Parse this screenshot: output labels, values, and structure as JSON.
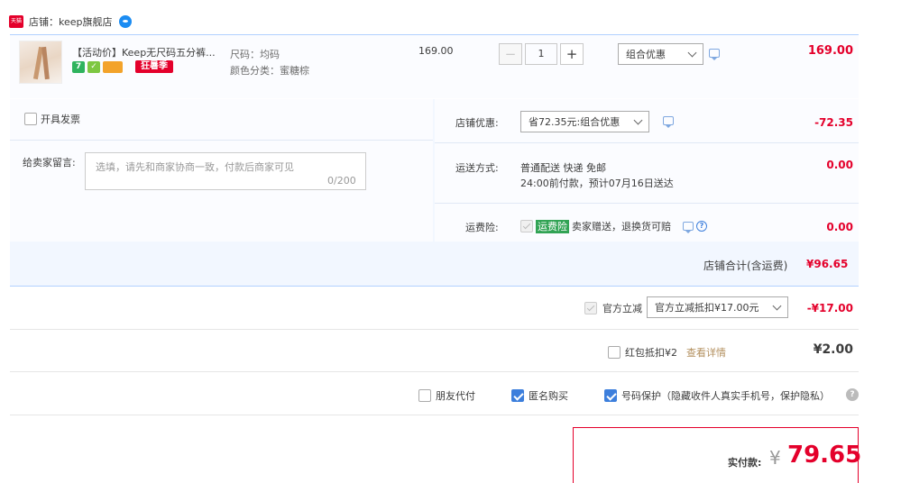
{
  "shop": {
    "badge": "天猫",
    "name": "店铺：keep旗舰店"
  },
  "item": {
    "title": "【活动价】Keep无尺码五分裤...",
    "promo_tag": "狂暑季",
    "sku_size": "尺码：均码",
    "sku_color": "颜色分类：蜜糖棕",
    "unit_price": "169.00",
    "quantity": "1",
    "minus": "−",
    "plus": "+",
    "promo_select": "组合优惠",
    "total": "169.00"
  },
  "invoice": {
    "label": "开具发票"
  },
  "message": {
    "label": "给卖家留言:",
    "placeholder": "选填，请先和商家协商一致，付款后商家可见",
    "count": "0/200"
  },
  "shop_discount": {
    "label": "店铺优惠:",
    "select": "省72.35元:组合优惠",
    "amount": "-72.35"
  },
  "shipping": {
    "label": "运送方式:",
    "method": "普通配送 快递 免邮",
    "eta": "24:00前付款，预计07月16日送达",
    "amount": "0.00"
  },
  "freight_insurance": {
    "label": "运费险:",
    "tag": "运费险",
    "desc": "卖家赠送，退换货可赔",
    "amount": "0.00"
  },
  "shop_total": {
    "label": "店铺合计(含运费)",
    "value": "¥96.65"
  },
  "official_discount": {
    "label": "官方立减",
    "select": "官方立减抵扣¥17.00元",
    "amount": "-¥17.00"
  },
  "red_packet": {
    "label": "红包抵扣¥2",
    "link": "查看详情",
    "amount": "¥2.00"
  },
  "options": {
    "friend_pay": "朋友代付",
    "anonymous": "匿名购买",
    "phone_protect": "号码保护（隐藏收件人真实手机号，保护隐私）",
    "help": "?"
  },
  "payment": {
    "label": "实付款:",
    "yen": "¥",
    "amount": "79.65"
  },
  "colors": {
    "accent_red": "#e4002b",
    "accent_blue": "#3d7fdc",
    "panel_bg": "#f2f7ff"
  }
}
